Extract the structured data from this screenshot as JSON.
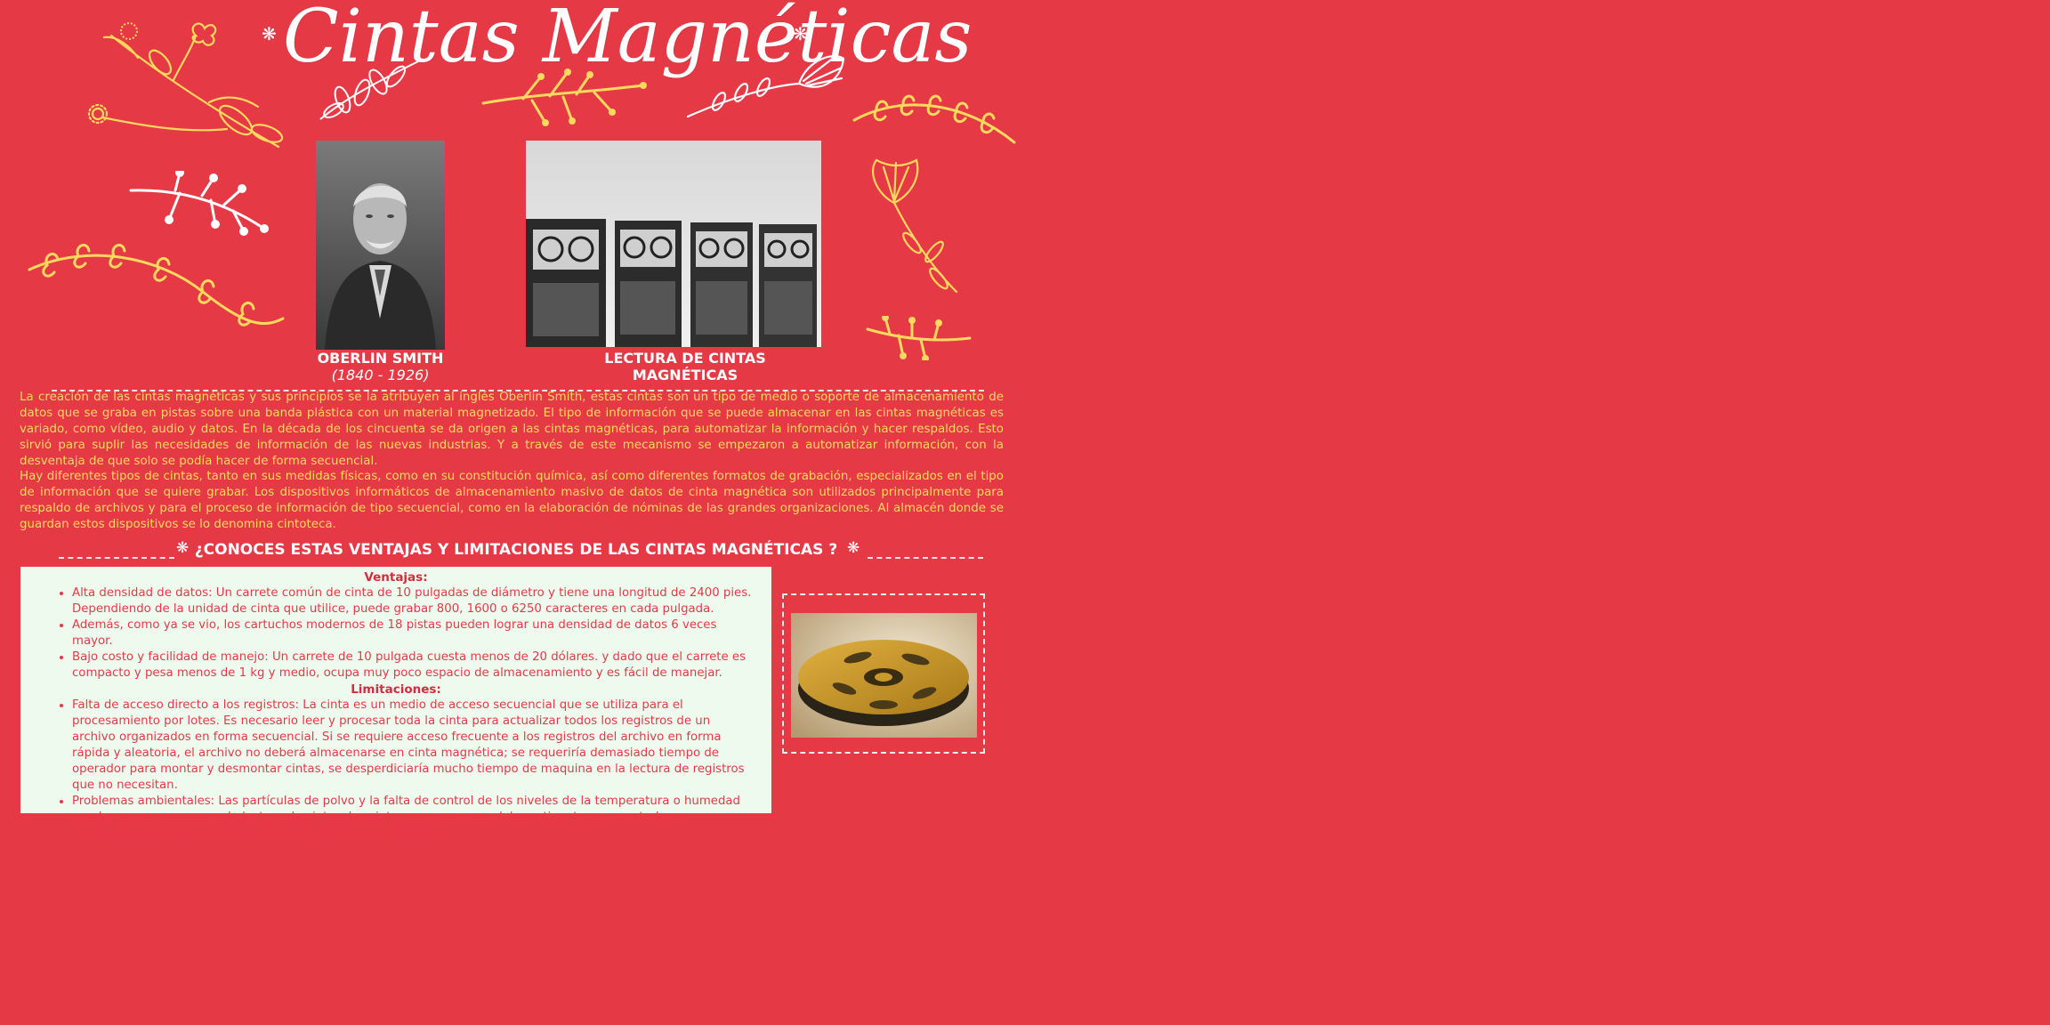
{
  "title": "Cintas Magnéticas",
  "star_glyph": "❋",
  "captions": {
    "person_name": "OBERLIN SMITH",
    "person_years": "(1840 - 1926)",
    "machines_line1": "LECTURA DE CINTAS",
    "machines_line2": "MAGNÉTICAS"
  },
  "paragraphs": [
    "La creación de las cintas magnéticas y sus principios se la atribuyen al inglés Oberlin Smith, estas cintas son un tipo de medio o soporte de almacenamiento de datos que se graba en pistas sobre una banda plástica con un material magnetizado. El tipo de información que se puede almacenar en las cintas magnéticas es variado, como vídeo, audio y datos. En la década de los cincuenta se da origen a las cintas magnéticas, para automatizar la información y hacer respaldos. Esto sirvió para suplir las necesidades de información de las nuevas industrias. Y a través de este mecanismo se empezaron a automatizar información, con la desventaja de que solo se podía hacer de forma secuencial.",
    "Hay diferentes tipos de cintas, tanto en sus medidas físicas, como en su constitución química, así como diferentes formatos de grabación, especializados en el tipo de información que se quiere grabar. Los dispositivos informáticos de almacenamiento masivo de datos de cinta magnética son utilizados principalmente para respaldo de archivos y para el proceso de información de tipo secuencial, como en la elaboración de nóminas de las grandes organizaciones. Al almacén donde se guardan estos dispositivos se lo denomina cintoteca."
  ],
  "section_heading": "¿CONOCES ESTAS VENTAJAS Y LIMITACIONES DE LAS CINTAS MAGNÉTICAS ?",
  "advantages": {
    "heading": "Ventajas:",
    "items": [
      "Alta densidad de datos: Un carrete común de cinta de 10 pulgadas de diámetro y tiene una longitud de 2400 pies. Dependiendo de la unidad de cinta que utilice, puede grabar 800, 1600 o 6250 caracteres en cada pulgada.",
      "Además, como ya se vio, los cartuchos modernos de 18 pistas pueden lograr una densidad de datos 6 veces mayor.",
      "Bajo costo y facilidad de manejo: Un carrete de 10 pulgada cuesta menos de 20 dólares. y dado que el carrete es compacto y pesa menos de 1 kg y medio, ocupa muy poco espacio de almacenamiento y es fácil de manejar."
    ]
  },
  "limitations": {
    "heading": "Limitaciones:",
    "items": [
      "Falta de acceso directo a los registros: La cinta es un medio de acceso secuencial que se utiliza para el procesamiento por lotes. Es necesario leer y procesar toda la cinta para actualizar todos los registros de un archivo organizados en forma secuencial. Si se requiere acceso frecuente a los registros del archivo en forma rápida y aleatoria, el archivo no deberá almacenarse en cinta magnética; se requeriría demasiado tiempo de operador para montar y desmontar cintas, se desperdiciaría mucho tiempo de maquina en la lectura de registros que no necesitan.",
      "Problemas ambientales: Las partículas de polvo y la falta de control de los niveles de la temperatura o humedad pueden causar errores en la lectura de cintas, las cintas y sus envases deben etiquetarse y controlarse cuidadosamente para no borrar por error un archivo importante."
    ]
  },
  "colors": {
    "background": "#e63946",
    "accent_yellow": "#ffd85e",
    "box_background": "#effaef",
    "text_white": "#ffffff"
  }
}
